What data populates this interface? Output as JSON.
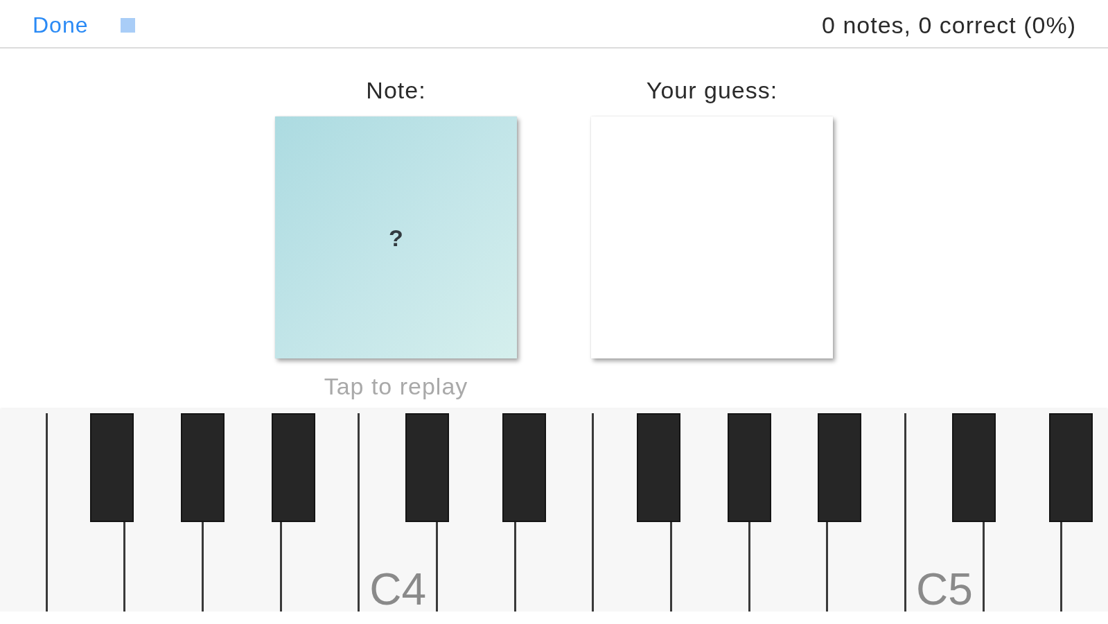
{
  "toolbar": {
    "done_button": {
      "label": "Done"
    },
    "stop_button": {
      "disabled": true
    },
    "score": "0 notes, 0 correct (0%)"
  },
  "note_panel": {
    "label": "Note:",
    "value": "?",
    "hint": "Tap to replay"
  },
  "guess_panel": {
    "label": "Your guess:"
  },
  "keyboard": {
    "keys": [
      {
        "kind": "natural"
      },
      {
        "kind": "natural"
      },
      {
        "kind": "sharp"
      },
      {
        "kind": "natural"
      },
      {
        "kind": "sharp"
      },
      {
        "kind": "natural"
      },
      {
        "kind": "sharp"
      },
      {
        "kind": "natural"
      },
      {
        "kind": "natural",
        "label": "C4"
      },
      {
        "kind": "sharp"
      },
      {
        "kind": "natural"
      },
      {
        "kind": "sharp"
      },
      {
        "kind": "natural"
      },
      {
        "kind": "natural"
      },
      {
        "kind": "sharp"
      },
      {
        "kind": "natural"
      },
      {
        "kind": "sharp"
      },
      {
        "kind": "natural"
      },
      {
        "kind": "sharp"
      },
      {
        "kind": "natural"
      },
      {
        "kind": "natural",
        "label": "C5"
      },
      {
        "kind": "sharp"
      },
      {
        "kind": "natural"
      },
      {
        "kind": "sharp"
      },
      {
        "kind": "natural"
      }
    ]
  }
}
